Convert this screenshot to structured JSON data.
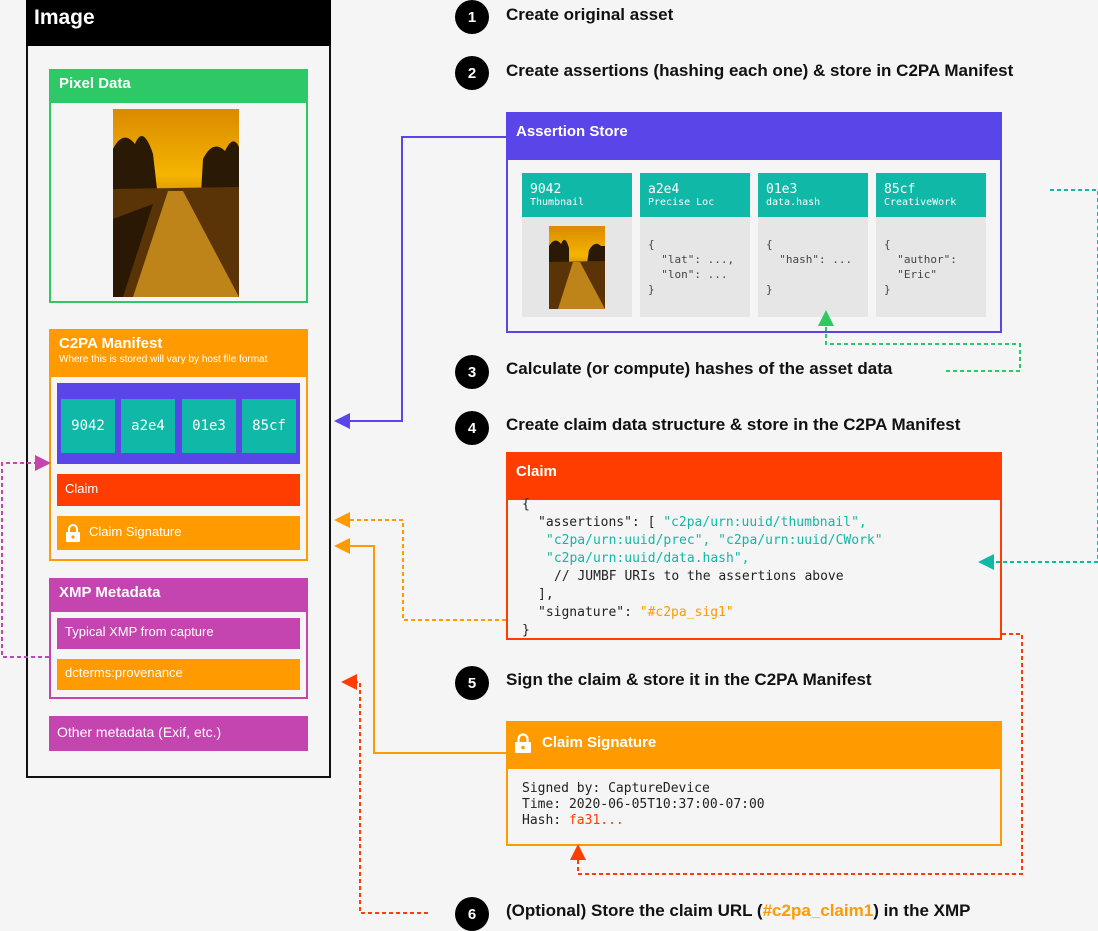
{
  "image": {
    "title": "Image",
    "pixel_data": {
      "title": "Pixel Data"
    },
    "manifest": {
      "title": "C2PA Manifest",
      "subtitle": "Where this is stored will vary by host file format",
      "chips": [
        "9042",
        "a2e4",
        "01e3",
        "85cf"
      ],
      "claim_label": "Claim",
      "signature_label": "Claim Signature"
    },
    "xmp": {
      "title": "XMP Metadata",
      "typical": "Typical XMP from capture",
      "provenance": "dcterms:provenance"
    },
    "other_meta": "Other metadata (Exif, etc.)"
  },
  "steps": [
    {
      "num": "1",
      "text": "Create original asset"
    },
    {
      "num": "2",
      "text": "Create assertions (hashing each one) & store in C2PA Manifest"
    },
    {
      "num": "3",
      "text": "Calculate (or compute) hashes of the asset data"
    },
    {
      "num": "4",
      "text": "Create claim data structure & store in the C2PA Manifest"
    },
    {
      "num": "5",
      "text": "Sign the claim & store it in the C2PA Manifest"
    },
    {
      "num": "6",
      "text_before": "(Optional) Store the claim URL (",
      "text_highlight": "#c2pa_claim1",
      "text_after": ") in the XMP"
    }
  ],
  "assertion_store": {
    "title": "Assertion Store",
    "cards": [
      {
        "id": "9042",
        "label": "Thumbnail",
        "body": ""
      },
      {
        "id": "a2e4",
        "label": "Precise Loc",
        "body": "{\n  \"lat\": ...,\n  \"lon\": ...\n}"
      },
      {
        "id": "01e3",
        "label": "data.hash",
        "body": "{\n  \"hash\": ...\n\n}"
      },
      {
        "id": "85cf",
        "label": "CreativeWork",
        "body": "{\n  \"author\":\n  \"Eric\"\n}"
      }
    ]
  },
  "claim": {
    "title": "Claim",
    "line1": "{",
    "line2_key": "\"assertions\": [ ",
    "line2_val": "\"c2pa/urn:uuid/thumbnail\",",
    "line3_val": "\"c2pa/urn:uuid/prec\", \"c2pa/urn:uuid/CWork\"",
    "line4_val": "\"c2pa/urn:uuid/data.hash\",",
    "line5": "// JUMBF URIs to the assertions above",
    "line6": "],",
    "line7_key": "\"signature\": ",
    "line7_val": "\"#c2pa_sig1\"",
    "line8": "}"
  },
  "claim_signature": {
    "title": "Claim Signature",
    "signed_by": "Signed by: CaptureDevice",
    "time": "Time: 2020-06-05T10:37:00-07:00",
    "hash_label": "Hash: ",
    "hash_value": "fa31..."
  },
  "colors": {
    "green": "#2ec866",
    "orange": "#ff9a00",
    "red": "#ff3d00",
    "purple": "#5a45e8",
    "magenta": "#c445b0",
    "teal": "#10b8a8"
  }
}
